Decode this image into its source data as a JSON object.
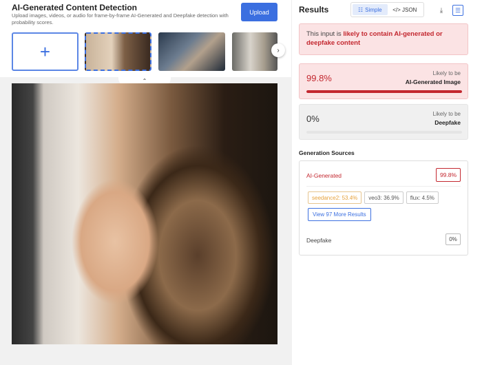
{
  "header": {
    "title": "AI-Generated Content Detection",
    "subtitle": "Upload images, videos, or audio for frame-by-frame AI-Generated and Deepfake detection with probability scores.",
    "upload_label": "Upload"
  },
  "gallery": {
    "add_icon": "+",
    "next_icon": "›",
    "collapse_icon": "⌃"
  },
  "results": {
    "title": "Results",
    "view_simple": "Simple",
    "view_json": "</> JSON",
    "alert_prefix": "This input is ",
    "alert_emphasis": "likely to contain AI-generated or deepfake content",
    "ai_card": {
      "percent": "99.8%",
      "label_top": "Likely to be",
      "label_bottom": "AI-Generated Image",
      "fill": 0.998
    },
    "deepfake_card": {
      "percent": "0%",
      "label_top": "Likely to be",
      "label_bottom": "Deepfake",
      "fill": 0.0
    }
  },
  "sources": {
    "title": "Generation Sources",
    "ai_label": "AI-Generated",
    "ai_percent": "99.8%",
    "chips": [
      "seedance2: 53.4%",
      "veo3: 36.9%",
      "flux: 4.5%"
    ],
    "more_label": "View 97 More Results",
    "deepfake_label": "Deepfake",
    "deepfake_percent": "0%"
  },
  "colors": {
    "accent": "#3b6fe0",
    "danger": "#c3272f",
    "warn": "#e6a23c"
  }
}
